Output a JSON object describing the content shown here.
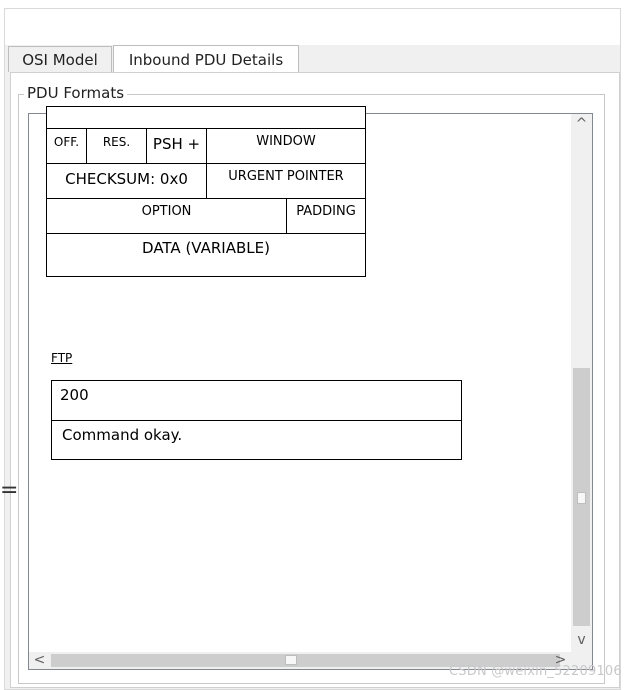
{
  "tabs": [
    {
      "label": "OSI Model",
      "active": false
    },
    {
      "label": "Inbound PDU Details",
      "active": true
    }
  ],
  "group": {
    "label": "PDU Formats"
  },
  "tcp": {
    "off": "OFF.",
    "res": "RES.",
    "flags": "PSH + ACK",
    "window": "WINDOW",
    "checksum": "CHECKSUM: 0x0",
    "urgent_pointer": "URGENT POINTER",
    "option": "OPTION",
    "padding": "PADDING",
    "data": "DATA (VARIABLE)"
  },
  "ftp": {
    "label": "FTP",
    "code": "200",
    "message": "Command okay."
  },
  "scrollbar": {
    "up": "^",
    "down": "v",
    "left": "<",
    "right": ">"
  },
  "watermark": "CSDN @weixin_52209106",
  "edge_glyph": "="
}
